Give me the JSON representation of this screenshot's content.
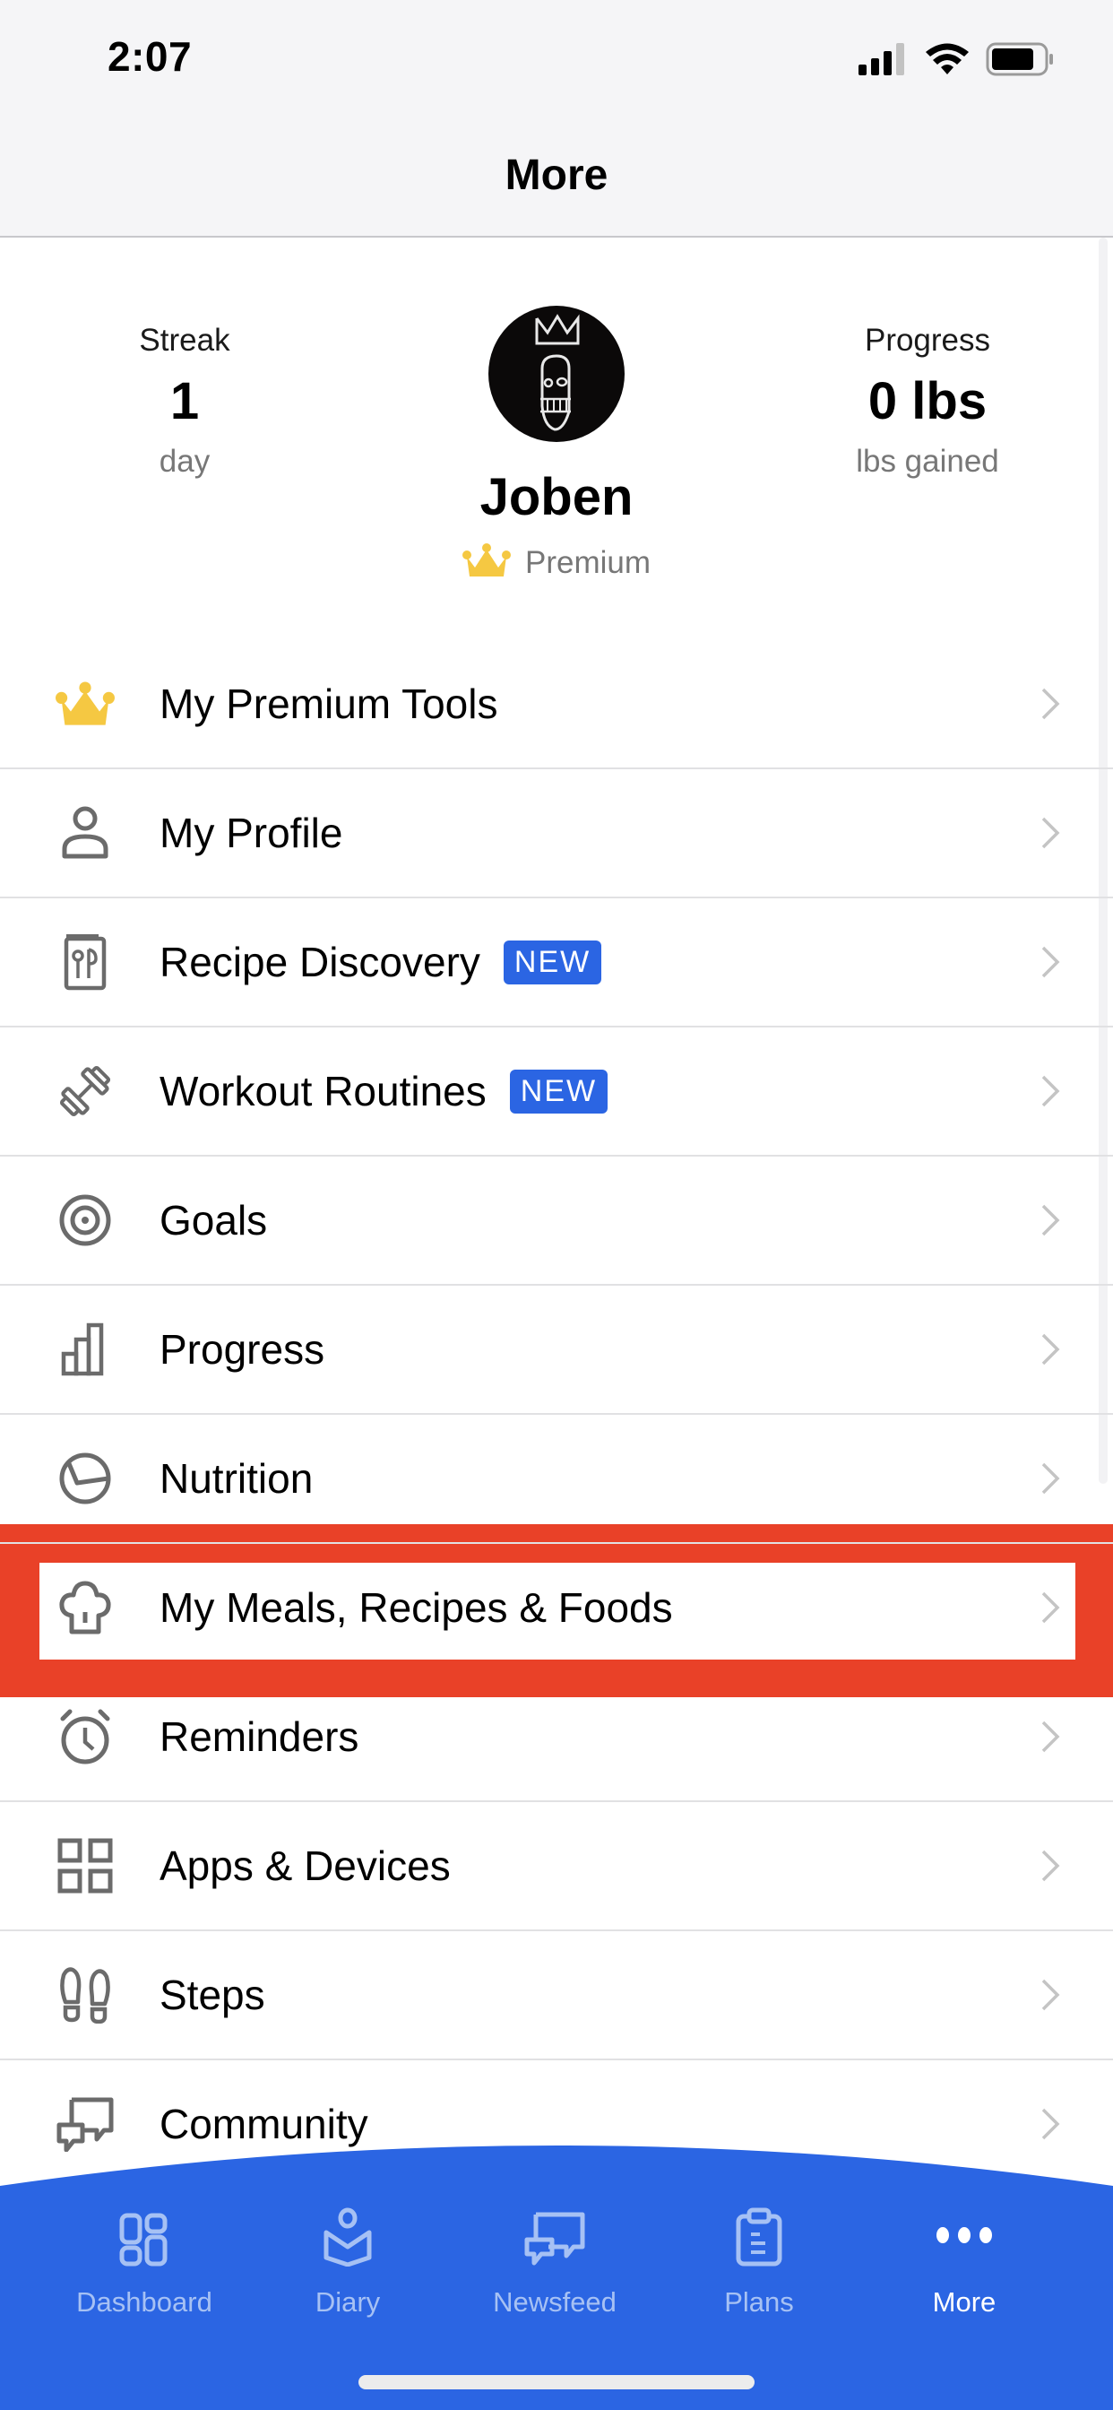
{
  "status_bar": {
    "time": "2:07",
    "signal_icon": "cellular-signal-icon",
    "wifi_icon": "wifi-icon",
    "battery_icon": "battery-icon"
  },
  "header": {
    "title": "More"
  },
  "profile": {
    "streak": {
      "label": "Streak",
      "value": "1",
      "unit": "day"
    },
    "progress": {
      "label": "Progress",
      "value": "0 lbs",
      "unit": "lbs gained"
    },
    "name": "Joben",
    "membership": "Premium",
    "membership_icon": "crown-icon",
    "avatar_icon": "avatar-image"
  },
  "menu": {
    "items": [
      {
        "label": "My Premium Tools",
        "icon": "crown-icon",
        "badge": ""
      },
      {
        "label": "My Profile",
        "icon": "person-icon",
        "badge": ""
      },
      {
        "label": "Recipe Discovery",
        "icon": "recipe-book-icon",
        "badge": "NEW"
      },
      {
        "label": "Workout Routines",
        "icon": "dumbbell-icon",
        "badge": "NEW"
      },
      {
        "label": "Goals",
        "icon": "target-icon",
        "badge": ""
      },
      {
        "label": "Progress",
        "icon": "bar-chart-icon",
        "badge": ""
      },
      {
        "label": "Nutrition",
        "icon": "pie-chart-icon",
        "badge": ""
      },
      {
        "label": "My Meals, Recipes & Foods",
        "icon": "chef-hat-icon",
        "badge": "",
        "highlighted": true
      },
      {
        "label": "Reminders",
        "icon": "alarm-clock-icon",
        "badge": ""
      },
      {
        "label": "Apps & Devices",
        "icon": "apps-grid-icon",
        "badge": ""
      },
      {
        "label": "Steps",
        "icon": "footprints-icon",
        "badge": ""
      },
      {
        "label": "Community",
        "icon": "chat-bubbles-icon",
        "badge": ""
      }
    ]
  },
  "tab_bar": {
    "tabs": [
      {
        "label": "Dashboard",
        "icon": "dashboard-icon",
        "active": false
      },
      {
        "label": "Diary",
        "icon": "diary-icon",
        "active": false
      },
      {
        "label": "Newsfeed",
        "icon": "newsfeed-icon",
        "active": false
      },
      {
        "label": "Plans",
        "icon": "clipboard-icon",
        "active": false
      },
      {
        "label": "More",
        "icon": "more-dots-icon",
        "active": true
      }
    ]
  },
  "colors": {
    "brand_blue": "#2b65e3",
    "highlight_red": "#e94128",
    "crown_gold": "#f5c842",
    "icon_gray": "#6b6b6b",
    "inactive_tab": "#a6c1f4"
  }
}
